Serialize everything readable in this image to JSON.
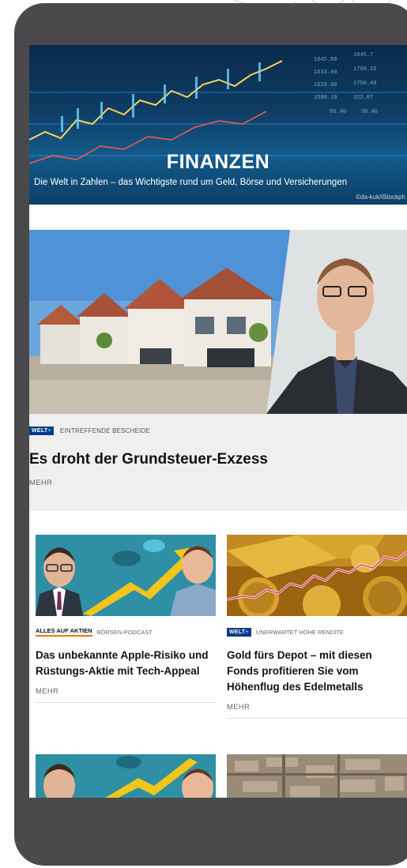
{
  "hero": {
    "title": "FINANZEN",
    "subtitle": "Die Welt in Zahlen – das Wichtigste rund um Geld, Börse und Versicherungen",
    "credit": "©da-kuk/iStockph"
  },
  "main_article": {
    "badge": "WELT",
    "badge_plus": "+",
    "kicker": "EINTREFFENDE BESCHEIDE",
    "title": "Es droht der Grundsteuer-Exzess",
    "more": "MEHR"
  },
  "teasers": [
    {
      "kicker_bold": "ALLES AUF AKTIEN",
      "kicker": "BÖRSEN-PODCAST",
      "title": "Das unbekannte Apple-Risiko und Rüstungs-Aktie mit Tech-Appeal",
      "more": "MEHR"
    },
    {
      "badge": "WELT",
      "badge_plus": "+",
      "kicker": "UNERWARTET HOHE RENDITE",
      "title": "Gold fürs Depot – mit diesen Fonds profitieren Sie vom Höhenflug des Edelmetalls",
      "more": "MEHR"
    }
  ],
  "colors": {
    "frame": "#4a4a4c",
    "welt_badge": "#0a3a88",
    "kicker_underline": "#e07b00",
    "article_bg": "#efefed"
  }
}
